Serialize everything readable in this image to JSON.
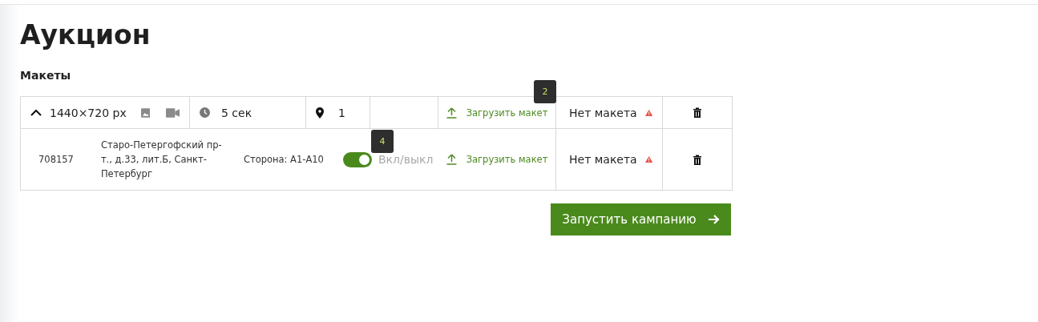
{
  "title": "Аукцион",
  "section": "Макеты",
  "header_row": {
    "expanded": true,
    "size": "1440×720 px",
    "duration": "5 сек",
    "locations": "1",
    "upload": "Загрузить макет",
    "status": "Нет макета",
    "badge": "2"
  },
  "rows": [
    {
      "id": "708157",
      "address": "Старо-Петергофский пр-т., д.33, лит.Б, Санкт-Петербург",
      "side": "Сторона: А1-А10",
      "enabled": true,
      "toggle_label": "Вкл/выкл",
      "badge": "4",
      "upload": "Загрузить макет",
      "status": "Нет макета"
    }
  ],
  "launch_button": "Запустить кампанию"
}
